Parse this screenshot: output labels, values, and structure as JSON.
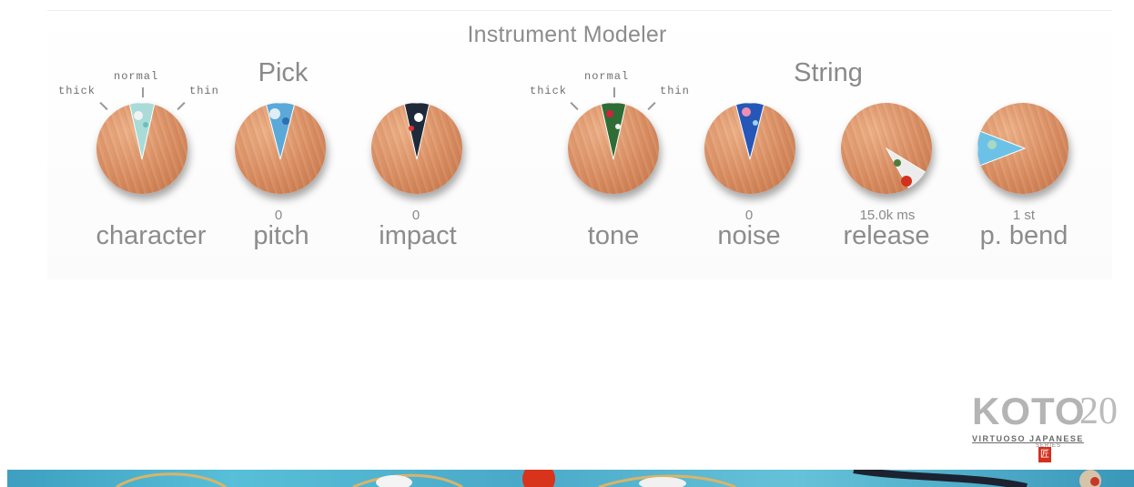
{
  "title": "Instrument Modeler",
  "sections": {
    "pick": "Pick",
    "string": "String"
  },
  "knobs": [
    {
      "id": "character",
      "label": "character",
      "value": "",
      "marks": [
        "thick",
        "normal",
        "thin"
      ]
    },
    {
      "id": "pitch",
      "label": "pitch",
      "value": "0"
    },
    {
      "id": "impact",
      "label": "impact",
      "value": "0"
    },
    {
      "id": "tone",
      "label": "tone",
      "value": "",
      "marks": [
        "thick",
        "normal",
        "thin"
      ]
    },
    {
      "id": "noise",
      "label": "noise",
      "value": "0"
    },
    {
      "id": "release",
      "label": "release",
      "value": "15.0k ms"
    },
    {
      "id": "pbend",
      "label": "p. bend",
      "value": "1 st"
    }
  ],
  "logo": {
    "name": "KOTO",
    "number": "20",
    "tagline": "VIRTUOSO JAPANESE",
    "series": "SERIES",
    "seal": "匠"
  },
  "colors": {
    "background": "#ffffff",
    "text": "#8c8c8c",
    "knob_wood": "#d98d62",
    "seal_red": "#d3301e",
    "banner": "#4aa9c8"
  },
  "icons": [
    "wood-knob-icon",
    "pointer-wedge-icon"
  ]
}
